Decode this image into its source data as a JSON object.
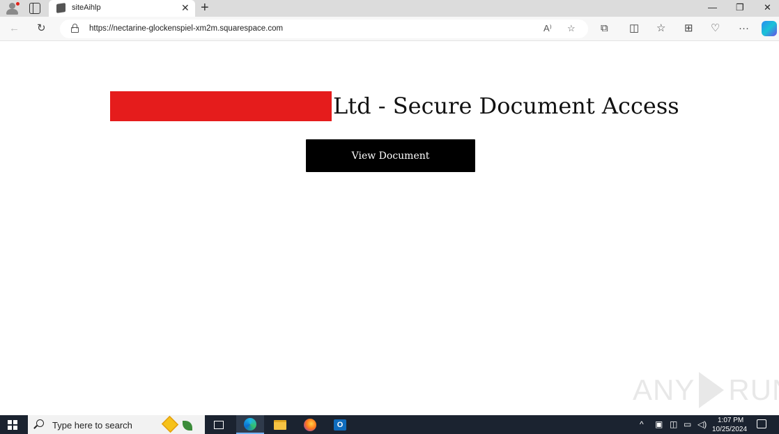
{
  "browser": {
    "tab_title": "siteAihlp",
    "url": "https://nectarine-glockenspiel-xm2m.squarespace.com",
    "read_aloud_label": "A⁾"
  },
  "page": {
    "heading_suffix": "Ltd - Secure Document Access",
    "view_button_label": "View Document",
    "redaction_color": "#e51c1c"
  },
  "watermark": {
    "left": "ANY",
    "right": "RUN"
  },
  "taskbar": {
    "search_placeholder": "Type here to search",
    "outlook_letter": "O",
    "time": "1:07 PM",
    "date": "10/25/2024"
  }
}
